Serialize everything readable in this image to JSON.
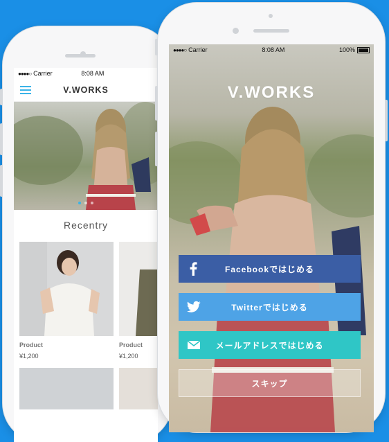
{
  "status_bar": {
    "carrier": "Carrier",
    "time": "8:08 AM",
    "battery": "100%"
  },
  "back_app": {
    "brand": "V.WORKS",
    "section_title": "Recentry",
    "products": [
      {
        "label": "Product",
        "price": "¥1,200"
      },
      {
        "label": "Product",
        "price": "¥1,200"
      }
    ]
  },
  "front_app": {
    "brand": "V.WORKS",
    "buttons": {
      "facebook": "Facebookではじめる",
      "twitter": "Twitterではじめる",
      "mail": "メールアドレスではじめる",
      "skip": "スキップ"
    }
  },
  "colors": {
    "background": "#1a8fe6",
    "accent": "#3bb4e8",
    "facebook": "#3b5ea5",
    "twitter": "#4ea3e6",
    "mail": "#2fc6c6"
  }
}
